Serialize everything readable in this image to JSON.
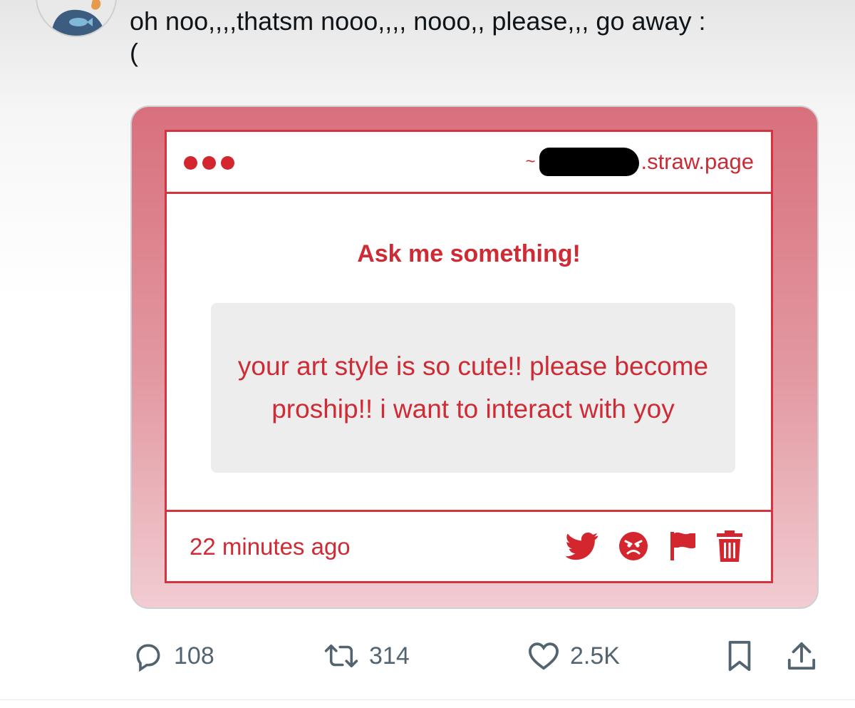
{
  "tweet": {
    "text": "oh noo,,,,thatsm nooo,,,, nooo,, please,,, go away :\n("
  },
  "screenshot": {
    "url_prefix": "~",
    "url_suffix": ".straw.page",
    "title": "Ask me something!",
    "question": "your art style is so cute!! please become proship!! i want to interact with yoy",
    "time_ago": "22 minutes ago",
    "icons": [
      "twitter-bird-icon",
      "angry-face-icon",
      "flag-icon",
      "trash-icon"
    ],
    "accent_color": "#d3262f"
  },
  "actions": {
    "replies": "108",
    "reposts": "314",
    "likes": "2.5K"
  },
  "colors": {
    "card_gradient_top": "#d8707c",
    "card_gradient_bottom": "#f1ccd1",
    "action_gray": "#536471"
  }
}
